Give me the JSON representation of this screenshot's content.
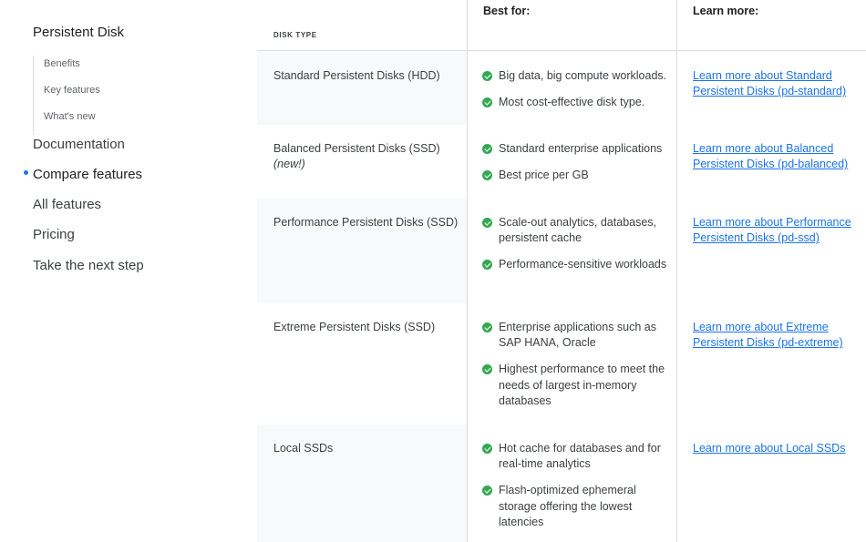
{
  "sidebar": {
    "title": "Persistent Disk",
    "subitems": [
      "Benefits",
      "Key features",
      "What's new"
    ],
    "items": [
      {
        "label": "Documentation"
      },
      {
        "label": "Compare features",
        "active": true
      },
      {
        "label": "All features"
      },
      {
        "label": "Pricing"
      },
      {
        "label": "Take the next step"
      }
    ],
    "accent": "#1a73e8"
  },
  "table": {
    "headers": {
      "type": "DISK TYPE",
      "best": "Best for:",
      "learn": "Learn more:"
    },
    "rows": [
      {
        "type": "Standard Persistent Disks (HDD)",
        "note": "",
        "best": [
          "Big data, big compute workloads.",
          "Most cost-effective disk type."
        ],
        "link": "Learn more about Standard Persistent Disks (pd-standard)"
      },
      {
        "type": "Balanced Persistent Disks (SSD)",
        "note": "(new!)",
        "best": [
          "Standard enterprise applications",
          "Best price per GB"
        ],
        "link": "Learn more about Balanced Persistent Disks (pd-balanced)"
      },
      {
        "type": "Performance Persistent Disks (SSD)",
        "note": "",
        "best": [
          "Scale-out analytics, databases, persistent cache",
          "Performance-sensitive workloads"
        ],
        "link": "Learn more about Performance Persistent Disks (pd-ssd)"
      },
      {
        "type": "Extreme Persistent Disks (SSD)",
        "note": "",
        "best": [
          "Enterprise applications such as SAP HANA, Oracle",
          "Highest performance to meet the needs of largest in-memory databases"
        ],
        "link": "Learn more about Extreme Persistent Disks (pd-extreme)"
      },
      {
        "type": "Local SSDs",
        "note": "",
        "best": [
          "Hot cache for databases and for real-time analytics",
          "Flash-optimized ephemeral storage offering the lowest latencies"
        ],
        "link": "Learn more about Local SSDs"
      }
    ],
    "check_color": "#34a853",
    "link_color": "#1a73e8"
  }
}
